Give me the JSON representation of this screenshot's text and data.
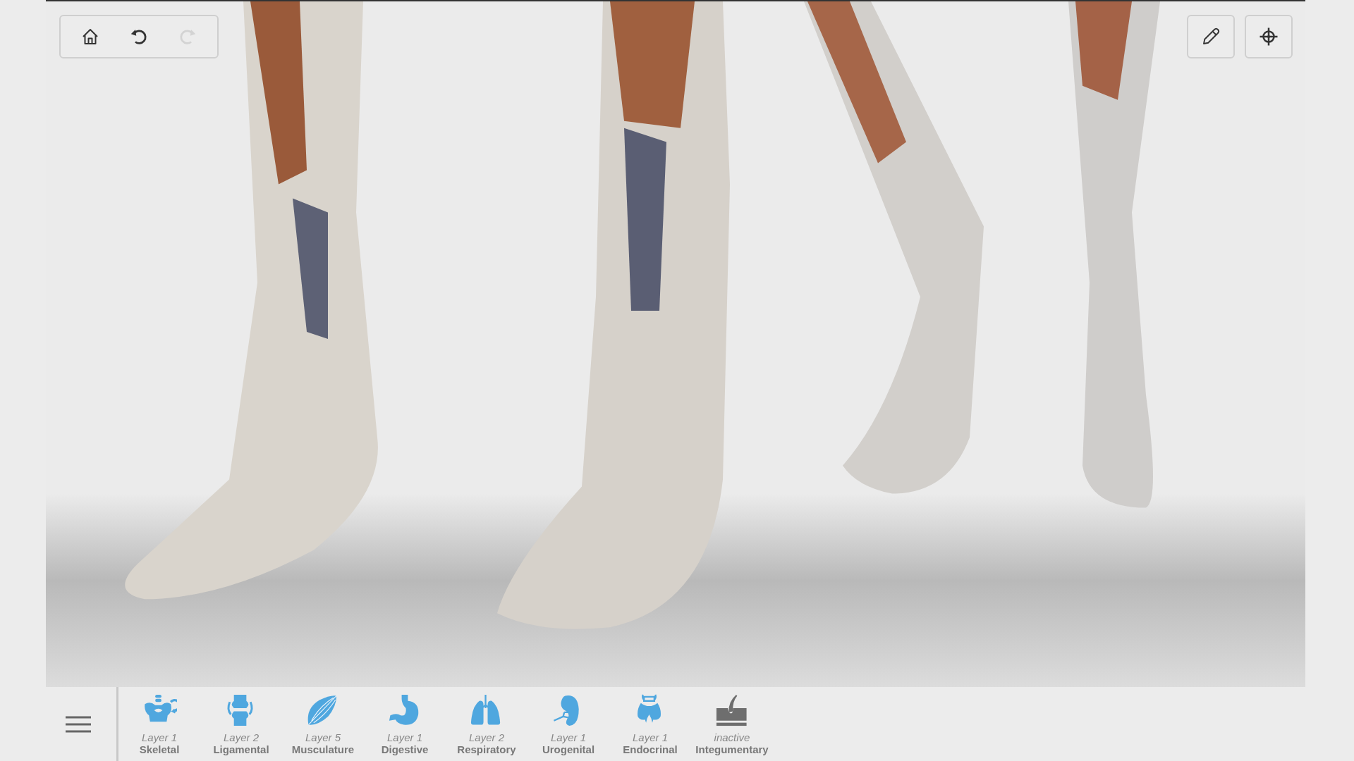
{
  "history_buttons": [
    {
      "disabled": false
    },
    {
      "disabled": false
    },
    {
      "disabled": true
    }
  ],
  "systems": [
    {
      "layer": "Layer 1",
      "name": "Skeletal",
      "active": true
    },
    {
      "layer": "Layer 2",
      "name": "Ligamental",
      "active": true
    },
    {
      "layer": "Layer 5",
      "name": "Musculature",
      "active": true
    },
    {
      "layer": "Layer 1",
      "name": "Digestive",
      "active": true
    },
    {
      "layer": "Layer 2",
      "name": "Respiratory",
      "active": true
    },
    {
      "layer": "Layer 1",
      "name": "Urogenital",
      "active": true
    },
    {
      "layer": "Layer 1",
      "name": "Endocrinal",
      "active": true
    },
    {
      "layer": "inactive",
      "name": "Integumentary",
      "active": false
    }
  ]
}
